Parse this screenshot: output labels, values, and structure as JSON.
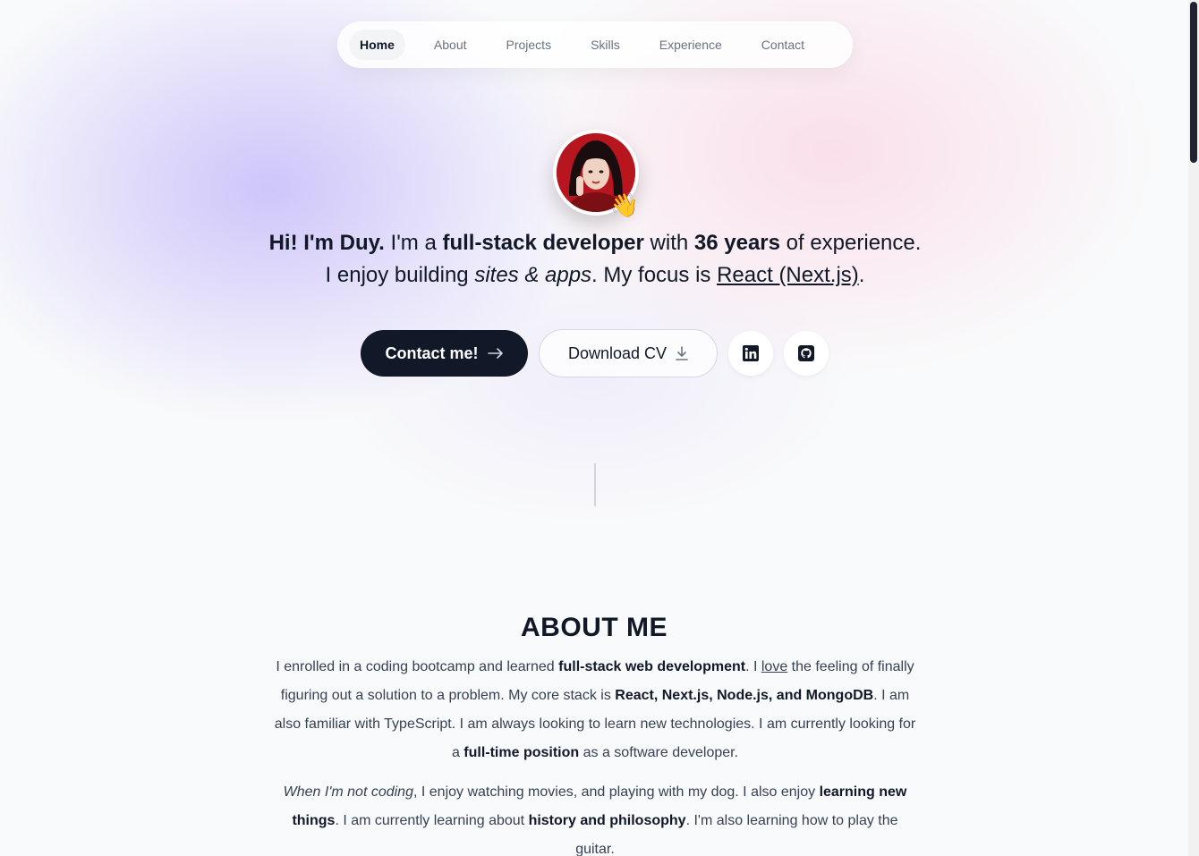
{
  "nav": {
    "items": [
      {
        "label": "Home",
        "active": true
      },
      {
        "label": "About"
      },
      {
        "label": "Projects"
      },
      {
        "label": "Skills"
      },
      {
        "label": "Experience"
      },
      {
        "label": "Contact"
      }
    ]
  },
  "hero": {
    "avatar_icon": "profile-photo",
    "wave_emoji": "👋",
    "line1": {
      "greeting": "Hi! I'm Duy.",
      "t1": " I'm a ",
      "role": "full-stack developer",
      "t2": " with ",
      "years": "36 years",
      "t3": " of experience."
    },
    "line2": {
      "t1": "I enjoy building ",
      "sites": "sites & apps",
      "t2": ". My focus is ",
      "focus": "React (Next.js)",
      "t3": "."
    },
    "buttons": {
      "contact_label": "Contact me!",
      "contact_icon": "arrow-right-icon",
      "cv_label": "Download CV",
      "cv_icon": "download-icon",
      "linkedin_icon": "linkedin-icon",
      "github_icon": "github-icon"
    }
  },
  "about": {
    "title": "ABOUT ME",
    "p1": {
      "a": "I enrolled in a coding bootcamp and learned ",
      "b": "full-stack web development",
      "c": ". I ",
      "d": "love",
      "e": " the feeling of finally figuring out a solution to a problem. My core stack is ",
      "f": "React, Next.js, Node.js, and MongoDB",
      "g": ". I am also familiar with TypeScript. I am always looking to learn new technologies. I am currently looking for a ",
      "h": "full-time position",
      "i": " as a software developer."
    },
    "p2": {
      "a": "When I'm not coding",
      "b": ", I enjoy watching movies, and playing with my dog. I also enjoy ",
      "c": "learning new things",
      "d": ". I am currently learning about ",
      "e": "history and philosophy",
      "f": ". I'm also learning how to play the guitar."
    }
  },
  "colors": {
    "primary_button": "#111827",
    "background": "#f9fafb",
    "accent_lavender": "#c7bcfa",
    "accent_pink": "#fadce8"
  }
}
